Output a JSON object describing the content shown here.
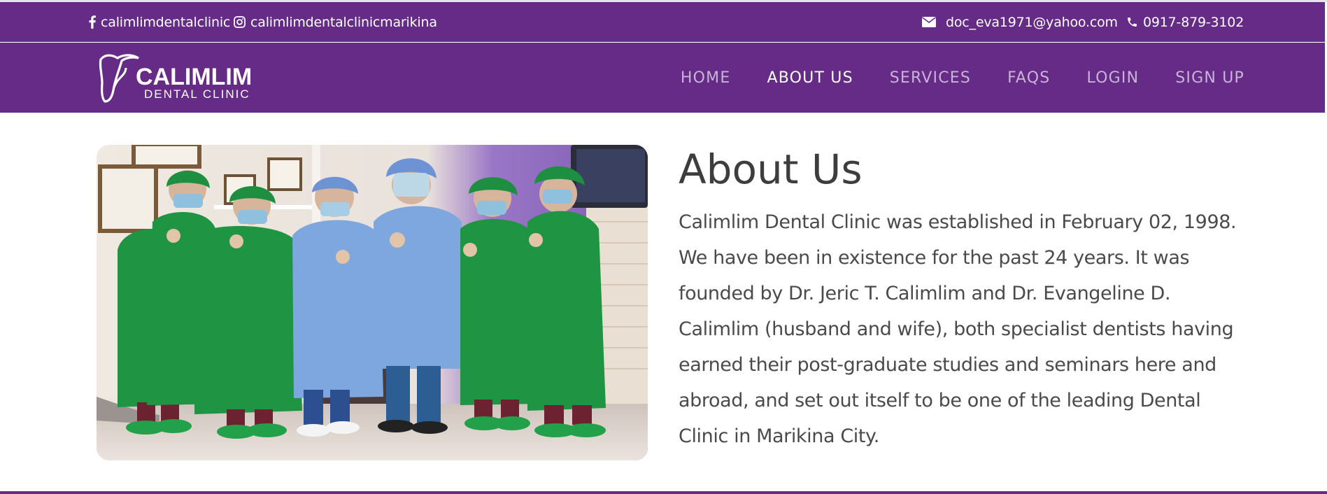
{
  "topbar": {
    "facebook": {
      "icon": "facebook-icon",
      "label": "calimlimdentalclinic"
    },
    "instagram": {
      "icon": "instagram-icon",
      "label": "calimlimdentalclinicmarikina"
    },
    "email": {
      "icon": "envelope-icon",
      "label": "doc_eva1971@yahoo.com"
    },
    "phone": {
      "icon": "phone-icon",
      "label": "0917-879-3102"
    }
  },
  "logo": {
    "icon": "tooth-icon",
    "name": "CALIMLIM",
    "sub": "DENTAL CLINIC"
  },
  "nav": {
    "items": [
      {
        "label": "HOME",
        "active": false
      },
      {
        "label": "ABOUT US",
        "active": true
      },
      {
        "label": "SERVICES",
        "active": false
      },
      {
        "label": "FAQS",
        "active": false
      },
      {
        "label": "LOGIN",
        "active": false
      },
      {
        "label": "SIGN UP",
        "active": false
      }
    ]
  },
  "about": {
    "heading": "About Us",
    "paragraph": "Calimlim Dental Clinic was established in February 02, 1998. We have been in existence for the past 24 years. It was founded by Dr. Jeric T. Calimlim and Dr. Evangeline D. Calimlim (husband and wife), both specialist dentists having earned their post-graduate studies and seminars here and abroad, and set out itself to be one of the leading Dental Clinic in Marikina City."
  },
  "colors": {
    "brand_purple": "#652b86",
    "nav_inactive": "#c9b3d9",
    "nav_active": "#ffffff",
    "text_dark": "#3d3d3d"
  }
}
